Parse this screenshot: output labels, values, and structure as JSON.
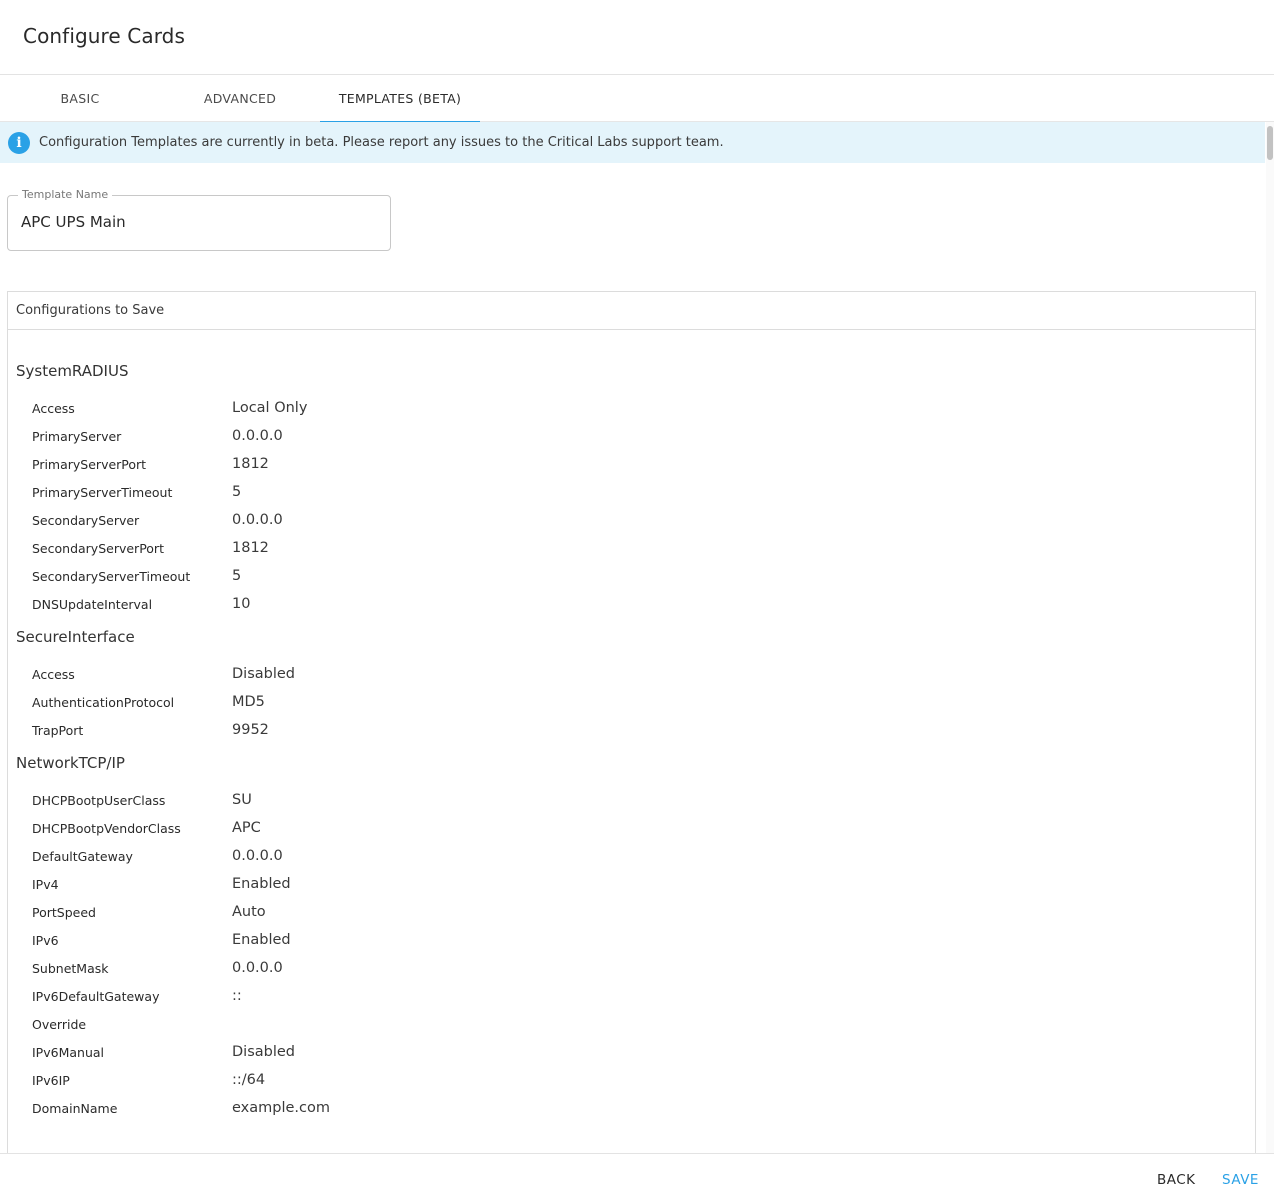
{
  "dialog": {
    "title": "Configure Cards"
  },
  "tabs": [
    {
      "label": "BASIC"
    },
    {
      "label": "ADVANCED"
    },
    {
      "label": "TEMPLATES (BETA)"
    }
  ],
  "banner": {
    "text": "Configuration Templates are currently in beta. Please report any issues to the Critical Labs support team."
  },
  "template_name": {
    "label": "Template Name",
    "value": "APC UPS Main"
  },
  "configs": {
    "header": "Configurations to Save",
    "sections": [
      {
        "title": "SystemRADIUS",
        "rows": [
          {
            "key": "Access",
            "value": "Local Only"
          },
          {
            "key": "PrimaryServer",
            "value": "0.0.0.0"
          },
          {
            "key": "PrimaryServerPort",
            "value": "1812"
          },
          {
            "key": "PrimaryServerTimeout",
            "value": "5"
          },
          {
            "key": "SecondaryServer",
            "value": "0.0.0.0"
          },
          {
            "key": "SecondaryServerPort",
            "value": "1812"
          },
          {
            "key": "SecondaryServerTimeout",
            "value": "5"
          },
          {
            "key": "DNSUpdateInterval",
            "value": "10"
          }
        ]
      },
      {
        "title": "SecureInterface",
        "rows": [
          {
            "key": "Access",
            "value": "Disabled"
          },
          {
            "key": "AuthenticationProtocol",
            "value": "MD5"
          },
          {
            "key": "TrapPort",
            "value": "9952"
          }
        ]
      },
      {
        "title": "NetworkTCP/IP",
        "rows": [
          {
            "key": "DHCPBootpUserClass",
            "value": "SU"
          },
          {
            "key": "DHCPBootpVendorClass",
            "value": "APC"
          },
          {
            "key": "DefaultGateway",
            "value": "0.0.0.0"
          },
          {
            "key": "IPv4",
            "value": "Enabled"
          },
          {
            "key": "PortSpeed",
            "value": "Auto"
          },
          {
            "key": "IPv6",
            "value": "Enabled"
          },
          {
            "key": "SubnetMask",
            "value": "0.0.0.0"
          },
          {
            "key": "IPv6DefaultGateway",
            "value": "::"
          },
          {
            "key": "Override",
            "value": ""
          },
          {
            "key": "IPv6Manual",
            "value": "Disabled"
          },
          {
            "key": "IPv6IP",
            "value": "::/64"
          },
          {
            "key": "DomainName",
            "value": "example.com"
          }
        ]
      }
    ]
  },
  "footer": {
    "back_label": "BACK",
    "save_label": "SAVE"
  },
  "colors": {
    "accent": "#2aa1e6",
    "banner_bg": "#e4f4fb"
  },
  "icons": {
    "info": "info-icon"
  }
}
